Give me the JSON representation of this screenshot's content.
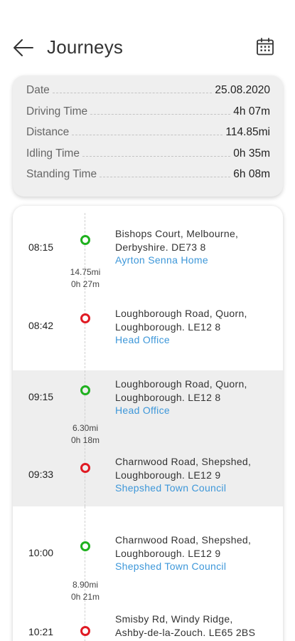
{
  "header": {
    "title": "Journeys"
  },
  "summary": [
    {
      "label": "Date",
      "value": "25.08.2020"
    },
    {
      "label": "Driving Time",
      "value": "4h 07m"
    },
    {
      "label": "Distance",
      "value": "114.85mi"
    },
    {
      "label": "Idling Time",
      "value": "0h 35m"
    },
    {
      "label": "Standing Time",
      "value": "6h 08m"
    }
  ],
  "journeys": [
    {
      "start": {
        "time": "08:15",
        "line1": "Bishops Court, Melbourne,",
        "line2": "Derbyshire. DE73 8",
        "place": "Ayrton Senna  Home"
      },
      "distance": "14.75mi",
      "duration": "0h 27m",
      "end": {
        "time": "08:42",
        "line1": "Loughborough Road, Quorn,",
        "line2": "Loughborough. LE12 8",
        "place": "Head Office"
      }
    },
    {
      "start": {
        "time": "09:15",
        "line1": "Loughborough Road, Quorn,",
        "line2": "Loughborough. LE12 8",
        "place": "Head Office"
      },
      "distance": "6.30mi",
      "duration": "0h 18m",
      "end": {
        "time": "09:33",
        "line1": "Charnwood Road, Shepshed,",
        "line2": "Loughborough. LE12 9",
        "place": "Shepshed Town Council"
      }
    },
    {
      "start": {
        "time": "10:00",
        "line1": "Charnwood Road, Shepshed,",
        "line2": "Loughborough. LE12 9",
        "place": "Shepshed Town Council"
      },
      "distance": "8.90mi",
      "duration": "0h 21m",
      "end": {
        "time": "10:21",
        "line1": "Smisby Rd, Windy Ridge,",
        "line2": "Ashby-de-la-Zouch. LE65 2BS",
        "place": ""
      }
    }
  ],
  "colors": {
    "start_marker": "#1fb11f",
    "end_marker": "#e01b24",
    "place_link": "#3d97d9",
    "alt_row": "#eeeeee"
  },
  "icons": {
    "back": "arrow-left-icon",
    "calendar": "calendar-icon"
  }
}
